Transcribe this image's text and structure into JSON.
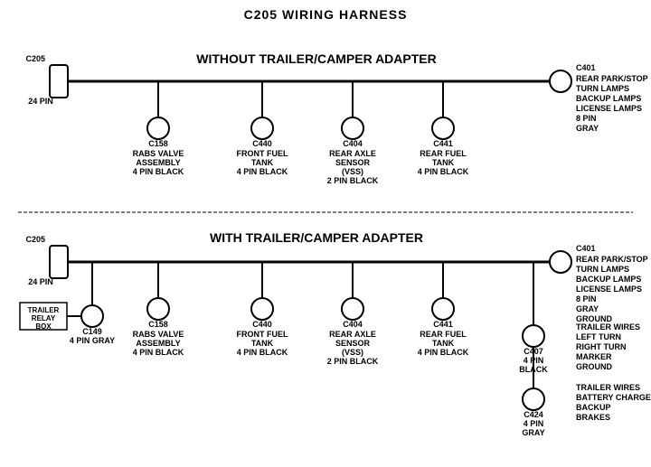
{
  "title": "C205 WIRING HARNESS",
  "section1": {
    "label": "WITHOUT TRAILER/CAMPER ADAPTER",
    "left_connector": {
      "name": "C205",
      "pins": "24 PIN"
    },
    "right_connector": {
      "name": "C401",
      "pins": "8 PIN",
      "color": "GRAY",
      "desc": "REAR PARK/STOP\nTURN LAMPS\nBACKUP LAMPS\nLICENSE LAMPS"
    },
    "sub_connectors": [
      {
        "name": "C158",
        "desc": "RABS VALVE\nASSEMBLY\n4 PIN BLACK"
      },
      {
        "name": "C440",
        "desc": "FRONT FUEL\nTANK\n4 PIN BLACK"
      },
      {
        "name": "C404",
        "desc": "REAR AXLE\nSENSOR\n(VSS)\n2 PIN BLACK"
      },
      {
        "name": "C441",
        "desc": "REAR FUEL\nTANK\n4 PIN BLACK"
      }
    ]
  },
  "section2": {
    "label": "WITH TRAILER/CAMPER ADAPTER",
    "left_connector": {
      "name": "C205",
      "pins": "24 PIN"
    },
    "right_connector": {
      "name": "C401",
      "pins": "8 PIN",
      "color": "GRAY",
      "desc": "REAR PARK/STOP\nTURN LAMPS\nBACKUP LAMPS\nLICENSE LAMPS\nGROUND"
    },
    "extra_left": {
      "name": "C149",
      "pins": "4 PIN GRAY",
      "box": "TRAILER\nRELAY\nBOX"
    },
    "sub_connectors": [
      {
        "name": "C158",
        "desc": "RABS VALVE\nASSEMBLY\n4 PIN BLACK"
      },
      {
        "name": "C440",
        "desc": "FRONT FUEL\nTANK\n4 PIN BLACK"
      },
      {
        "name": "C404",
        "desc": "REAR AXLE\nSENSOR\n(VSS)\n2 PIN BLACK"
      },
      {
        "name": "C441",
        "desc": "REAR FUEL\nTANK\n4 PIN BLACK"
      }
    ],
    "right_extra": [
      {
        "name": "C407",
        "pins": "4 PIN\nBLACK",
        "desc": "TRAILER WIRES\nLEFT TURN\nRIGHT TURN\nMARKER\nGROUND"
      },
      {
        "name": "C424",
        "pins": "4 PIN\nGRAY",
        "desc": "TRAILER WIRES\nBATTERY CHARGE\nBACKUP\nBRAKES"
      }
    ]
  }
}
